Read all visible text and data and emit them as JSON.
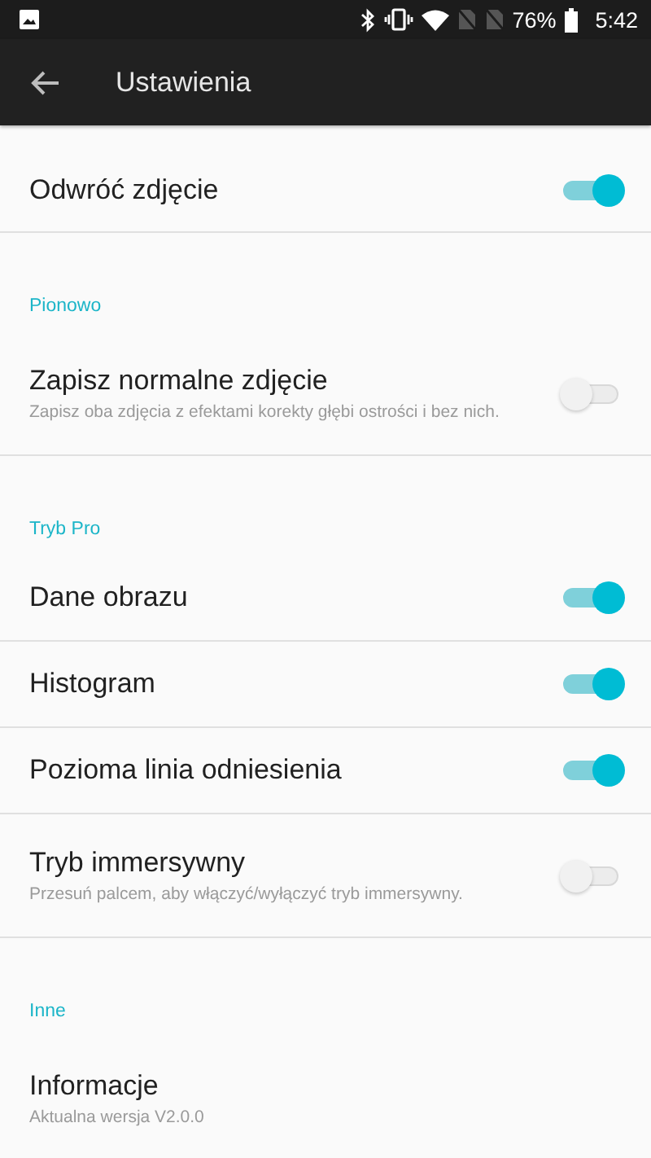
{
  "status_bar": {
    "battery": "76%",
    "time": "5:42"
  },
  "app_bar": {
    "title": "Ustawienia"
  },
  "sections": [
    {
      "items": [
        {
          "kind": "toggle",
          "title": "Odwróć zdjęcie",
          "on": true
        }
      ]
    },
    {
      "header": "Pionowo",
      "items": [
        {
          "kind": "toggle",
          "title": "Zapisz normalne zdjęcie",
          "subtitle": "Zapisz oba zdjęcia z efektami korekty głębi ostrości i bez nich.",
          "on": false
        }
      ]
    },
    {
      "header": "Tryb Pro",
      "items": [
        {
          "kind": "toggle",
          "title": "Dane obrazu",
          "on": true
        },
        {
          "kind": "toggle",
          "title": "Histogram",
          "on": true
        },
        {
          "kind": "toggle",
          "title": "Pozioma linia odniesienia",
          "on": true
        },
        {
          "kind": "toggle",
          "title": "Tryb immersywny",
          "subtitle": "Przesuń palcem, aby włączyć/wyłączyć tryb immersywny.",
          "on": false
        }
      ]
    },
    {
      "header": "Inne",
      "items": [
        {
          "kind": "info",
          "title": "Informacje",
          "subtitle": "Aktualna wersja V2.0.0"
        }
      ]
    }
  ]
}
